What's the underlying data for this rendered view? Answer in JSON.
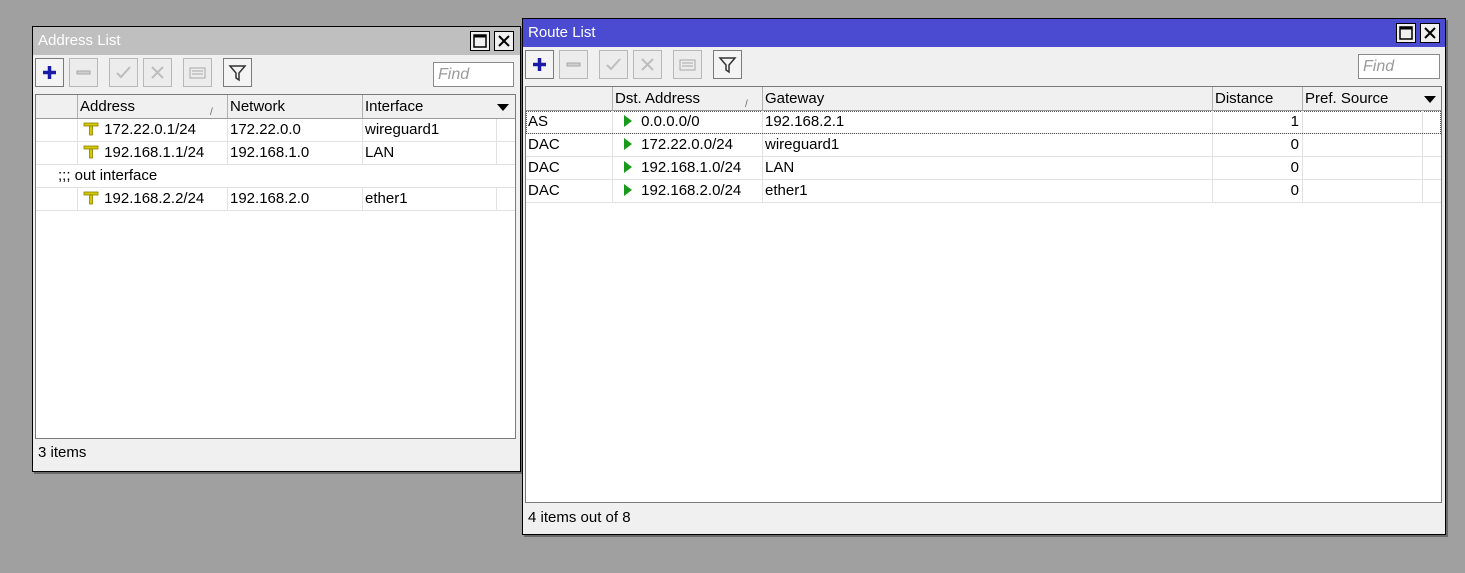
{
  "address_window": {
    "title": "Address List",
    "find_placeholder": "Find",
    "columns": [
      "Address",
      "Network",
      "Interface"
    ],
    "rows": [
      {
        "address": "172.22.0.1/24",
        "network": "172.22.0.0",
        "interface": "wireguard1"
      },
      {
        "address": "192.168.1.1/24",
        "network": "192.168.1.0",
        "interface": "LAN"
      },
      {
        "comment": ";;; out interface"
      },
      {
        "address": "192.168.2.2/24",
        "network": "192.168.2.0",
        "interface": "ether1"
      }
    ],
    "status": "3 items"
  },
  "route_window": {
    "title": "Route List",
    "find_placeholder": "Find",
    "columns": [
      "Dst. Address",
      "Gateway",
      "Distance",
      "Pref. Source"
    ],
    "rows": [
      {
        "flags": "AS",
        "dst": "0.0.0.0/0",
        "gateway": "192.168.2.1",
        "distance": "1",
        "pref_source": ""
      },
      {
        "flags": "DAC",
        "dst": "172.22.0.0/24",
        "gateway": "wireguard1",
        "distance": "0",
        "pref_source": ""
      },
      {
        "flags": "DAC",
        "dst": "192.168.1.0/24",
        "gateway": "LAN",
        "distance": "0",
        "pref_source": ""
      },
      {
        "flags": "DAC",
        "dst": "192.168.2.0/24",
        "gateway": "ether1",
        "distance": "0",
        "pref_source": ""
      }
    ],
    "status": "4 items out of 8"
  },
  "colors": {
    "active_title": "#4a4bd0",
    "inactive_title": "#bfbfbf",
    "route_icon": "#1a9a1a",
    "address_icon": "#d6c800"
  },
  "icons": [
    "add-icon",
    "remove-icon",
    "enable-icon",
    "disable-icon",
    "comment-icon",
    "filter-icon",
    "maximize-icon",
    "close-icon"
  ]
}
